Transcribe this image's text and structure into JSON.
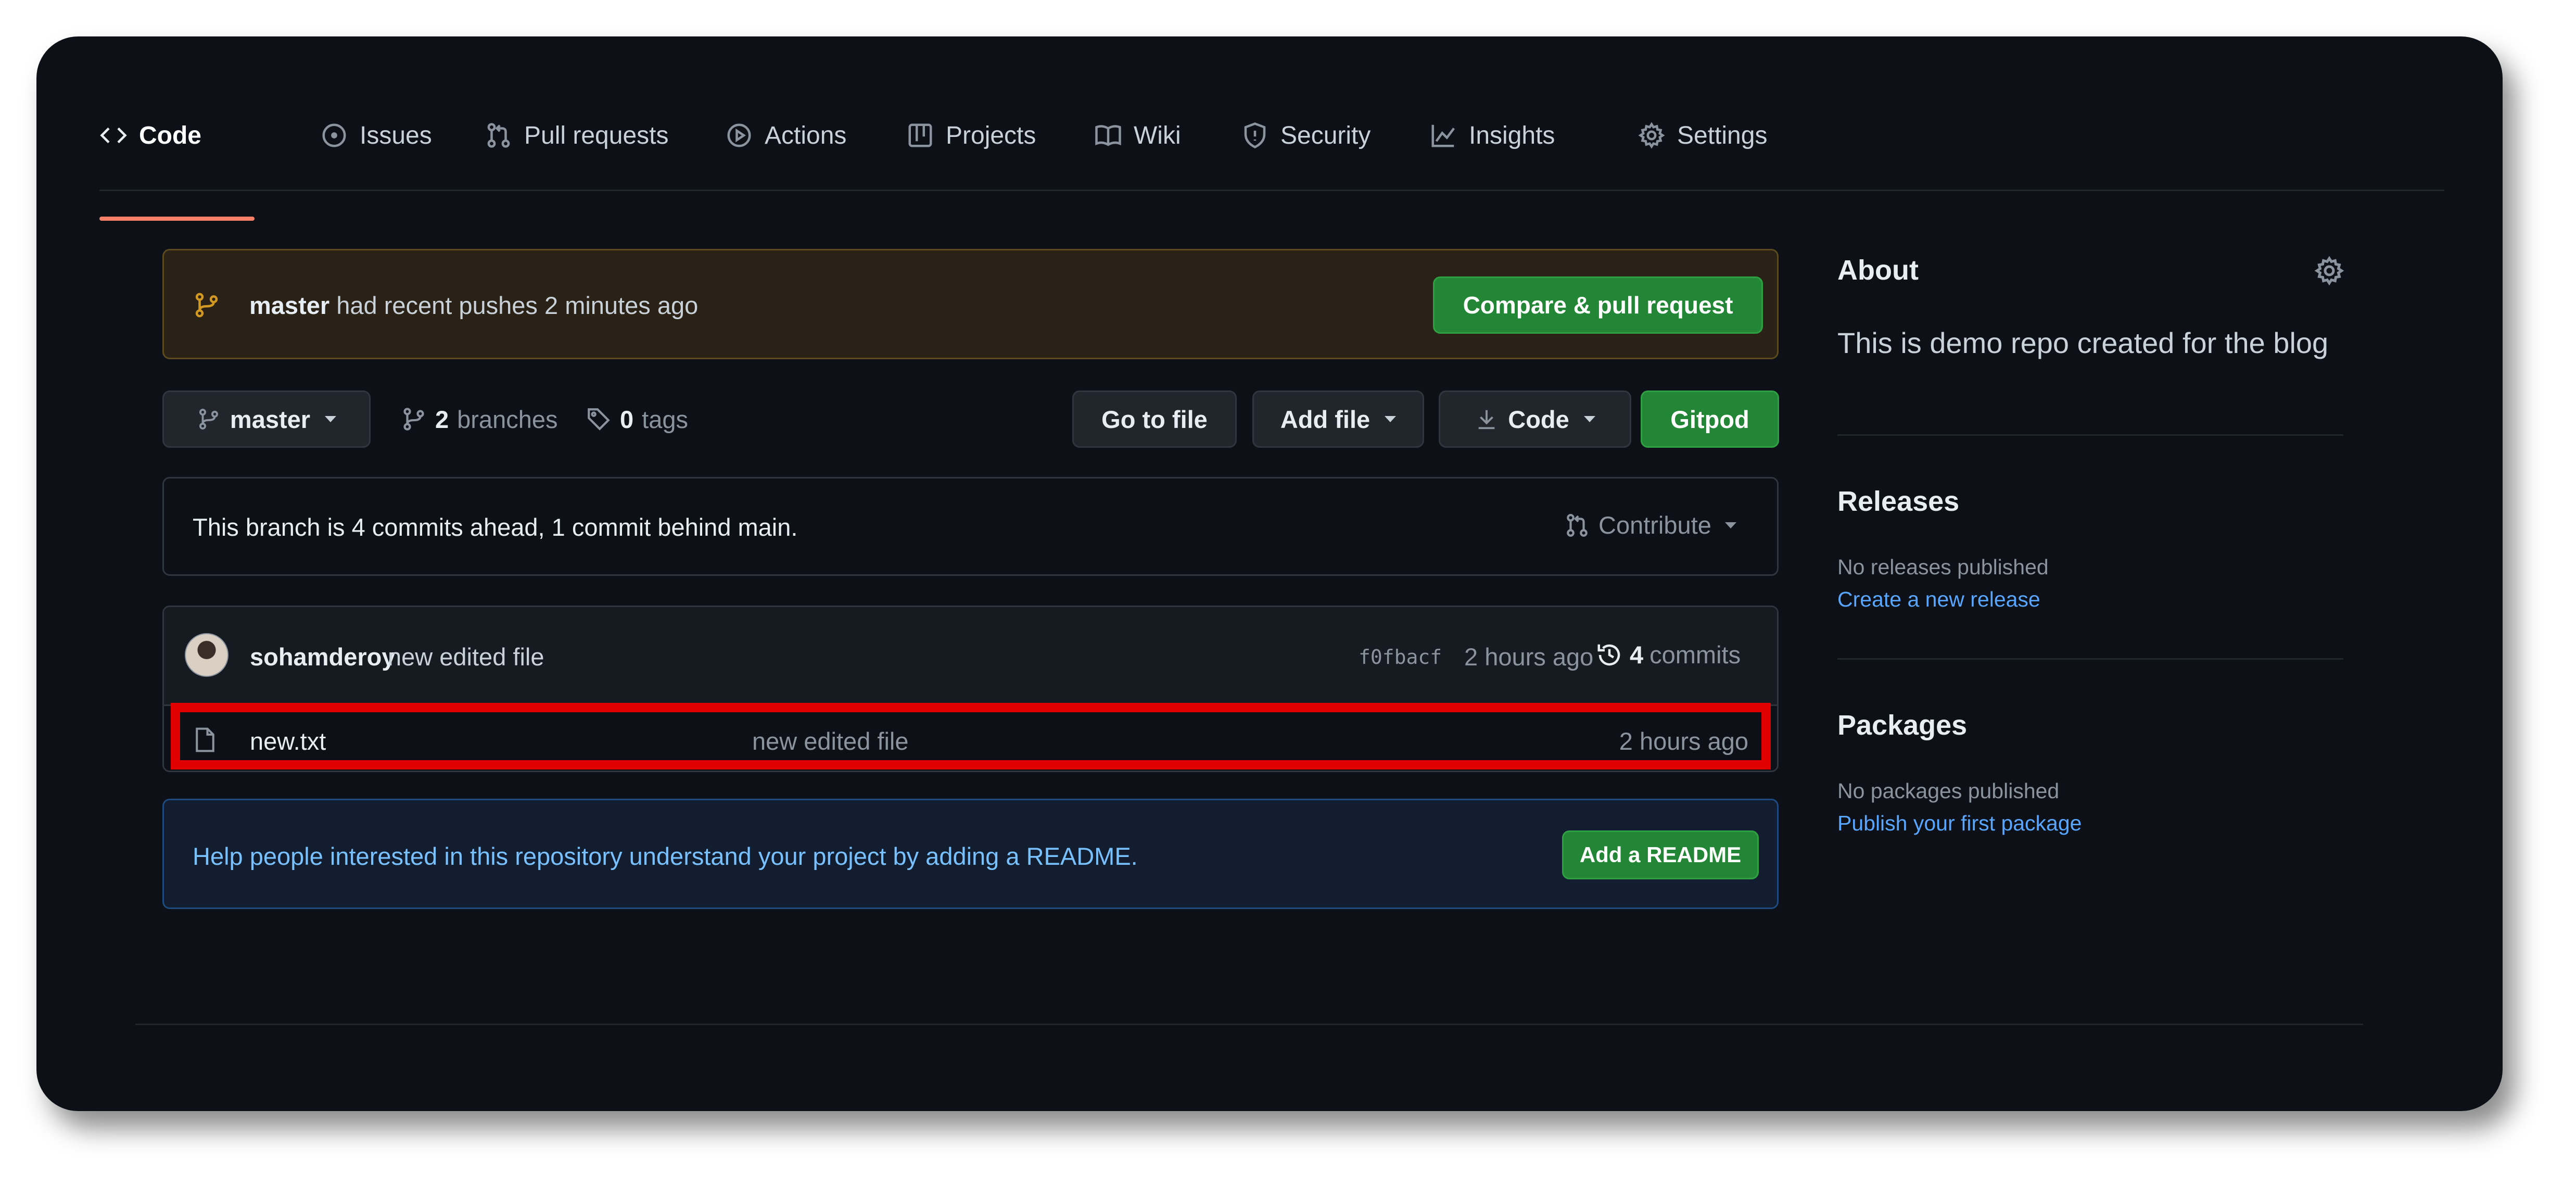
{
  "tabs": [
    {
      "label": "Code",
      "icon": "code-icon",
      "active": true
    },
    {
      "label": "Issues",
      "icon": "issue-icon"
    },
    {
      "label": "Pull requests",
      "icon": "pull-request-icon"
    },
    {
      "label": "Actions",
      "icon": "play-icon"
    },
    {
      "label": "Projects",
      "icon": "project-table-icon"
    },
    {
      "label": "Wiki",
      "icon": "book-icon"
    },
    {
      "label": "Security",
      "icon": "shield-icon"
    },
    {
      "label": "Insights",
      "icon": "graph-icon"
    },
    {
      "label": "Settings",
      "icon": "gear-icon"
    }
  ],
  "banner": {
    "branch": "master",
    "message": "had recent pushes 2 minutes ago",
    "button": "Compare & pull request"
  },
  "toolbar": {
    "branch": "master",
    "branches_count": "2",
    "branches_label": "branches",
    "tags_count": "0",
    "tags_label": "tags",
    "goto_file": "Go to file",
    "add_file": "Add file",
    "code": "Code",
    "gitpod": "Gitpod"
  },
  "ahead_behind": {
    "text": "This branch is 4 commits ahead, 1 commit behind main.",
    "contribute": "Contribute"
  },
  "latest_commit": {
    "author": "sohamderoy",
    "message": "new edited file",
    "sha": "f0fbacf",
    "time": "2 hours ago",
    "commits_count": "4",
    "commits_label": "commits"
  },
  "files": [
    {
      "name": "new.txt",
      "commit_message": "new edited file",
      "time": "2 hours ago"
    }
  ],
  "readme_prompt": {
    "text": "Help people interested in this repository understand your project by adding a README.",
    "button": "Add a README"
  },
  "sidebar": {
    "about": {
      "title": "About",
      "description": "This is demo repo created for the blog"
    },
    "releases": {
      "title": "Releases",
      "empty": "No releases published",
      "link": "Create a new release"
    },
    "packages": {
      "title": "Packages",
      "empty": "No packages published",
      "link": "Publish your first package"
    }
  },
  "colors": {
    "background": "#0d1117",
    "accent_underline": "#f78166",
    "primary_button": "#238636",
    "link": "#58a6ff",
    "highlight": "#e00000"
  }
}
